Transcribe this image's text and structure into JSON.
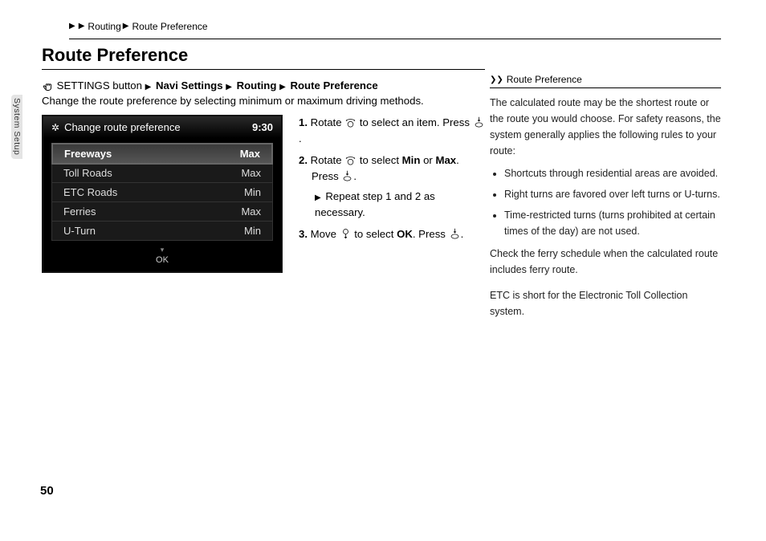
{
  "breadcrumb": {
    "seg1": "Routing",
    "seg2": "Route Preference"
  },
  "side_tab": "System Setup",
  "page_number": "50",
  "title": "Route Preference",
  "nav_path": {
    "btn": "SETTINGS button",
    "s1": "Navi Settings",
    "s2": "Routing",
    "s3": "Route Preference"
  },
  "description": "Change the route preference by selecting minimum or maximum driving methods.",
  "screenshot": {
    "title": "Change route preference",
    "time": "9:30",
    "rows": [
      {
        "label": "Freeways",
        "value": "Max"
      },
      {
        "label": "Toll Roads",
        "value": "Max"
      },
      {
        "label": "ETC Roads",
        "value": "Min"
      },
      {
        "label": "Ferries",
        "value": "Max"
      },
      {
        "label": "U-Turn",
        "value": "Min"
      }
    ],
    "ok": "OK"
  },
  "steps": {
    "s1a": "Rotate",
    "s1b": "to select an item. Press",
    "s1c": ".",
    "s2a": "Rotate",
    "s2b": "to select",
    "s2c": "Min",
    "s2d": "or",
    "s2e": "Max",
    "s2f": ".",
    "s2g": "Press",
    "s2h": ".",
    "repeat": "Repeat step 1 and 2 as necessary.",
    "s3a": "Move",
    "s3b": "to select",
    "s3c": "OK",
    "s3d": ". Press",
    "s3e": "."
  },
  "sidebar": {
    "title": "Route Preference",
    "intro": "The calculated route may be the shortest route or the route you would choose. For safety reasons, the system generally applies the following rules to your route:",
    "bullets": [
      "Shortcuts through residential areas are avoided.",
      "Right turns are favored over left turns or U-turns.",
      "Time-restricted turns (turns prohibited at certain times of the day) are not used."
    ],
    "p2": "Check the ferry schedule when the calculated route includes ferry route.",
    "p3": "ETC is short for the Electronic Toll Collection system."
  }
}
